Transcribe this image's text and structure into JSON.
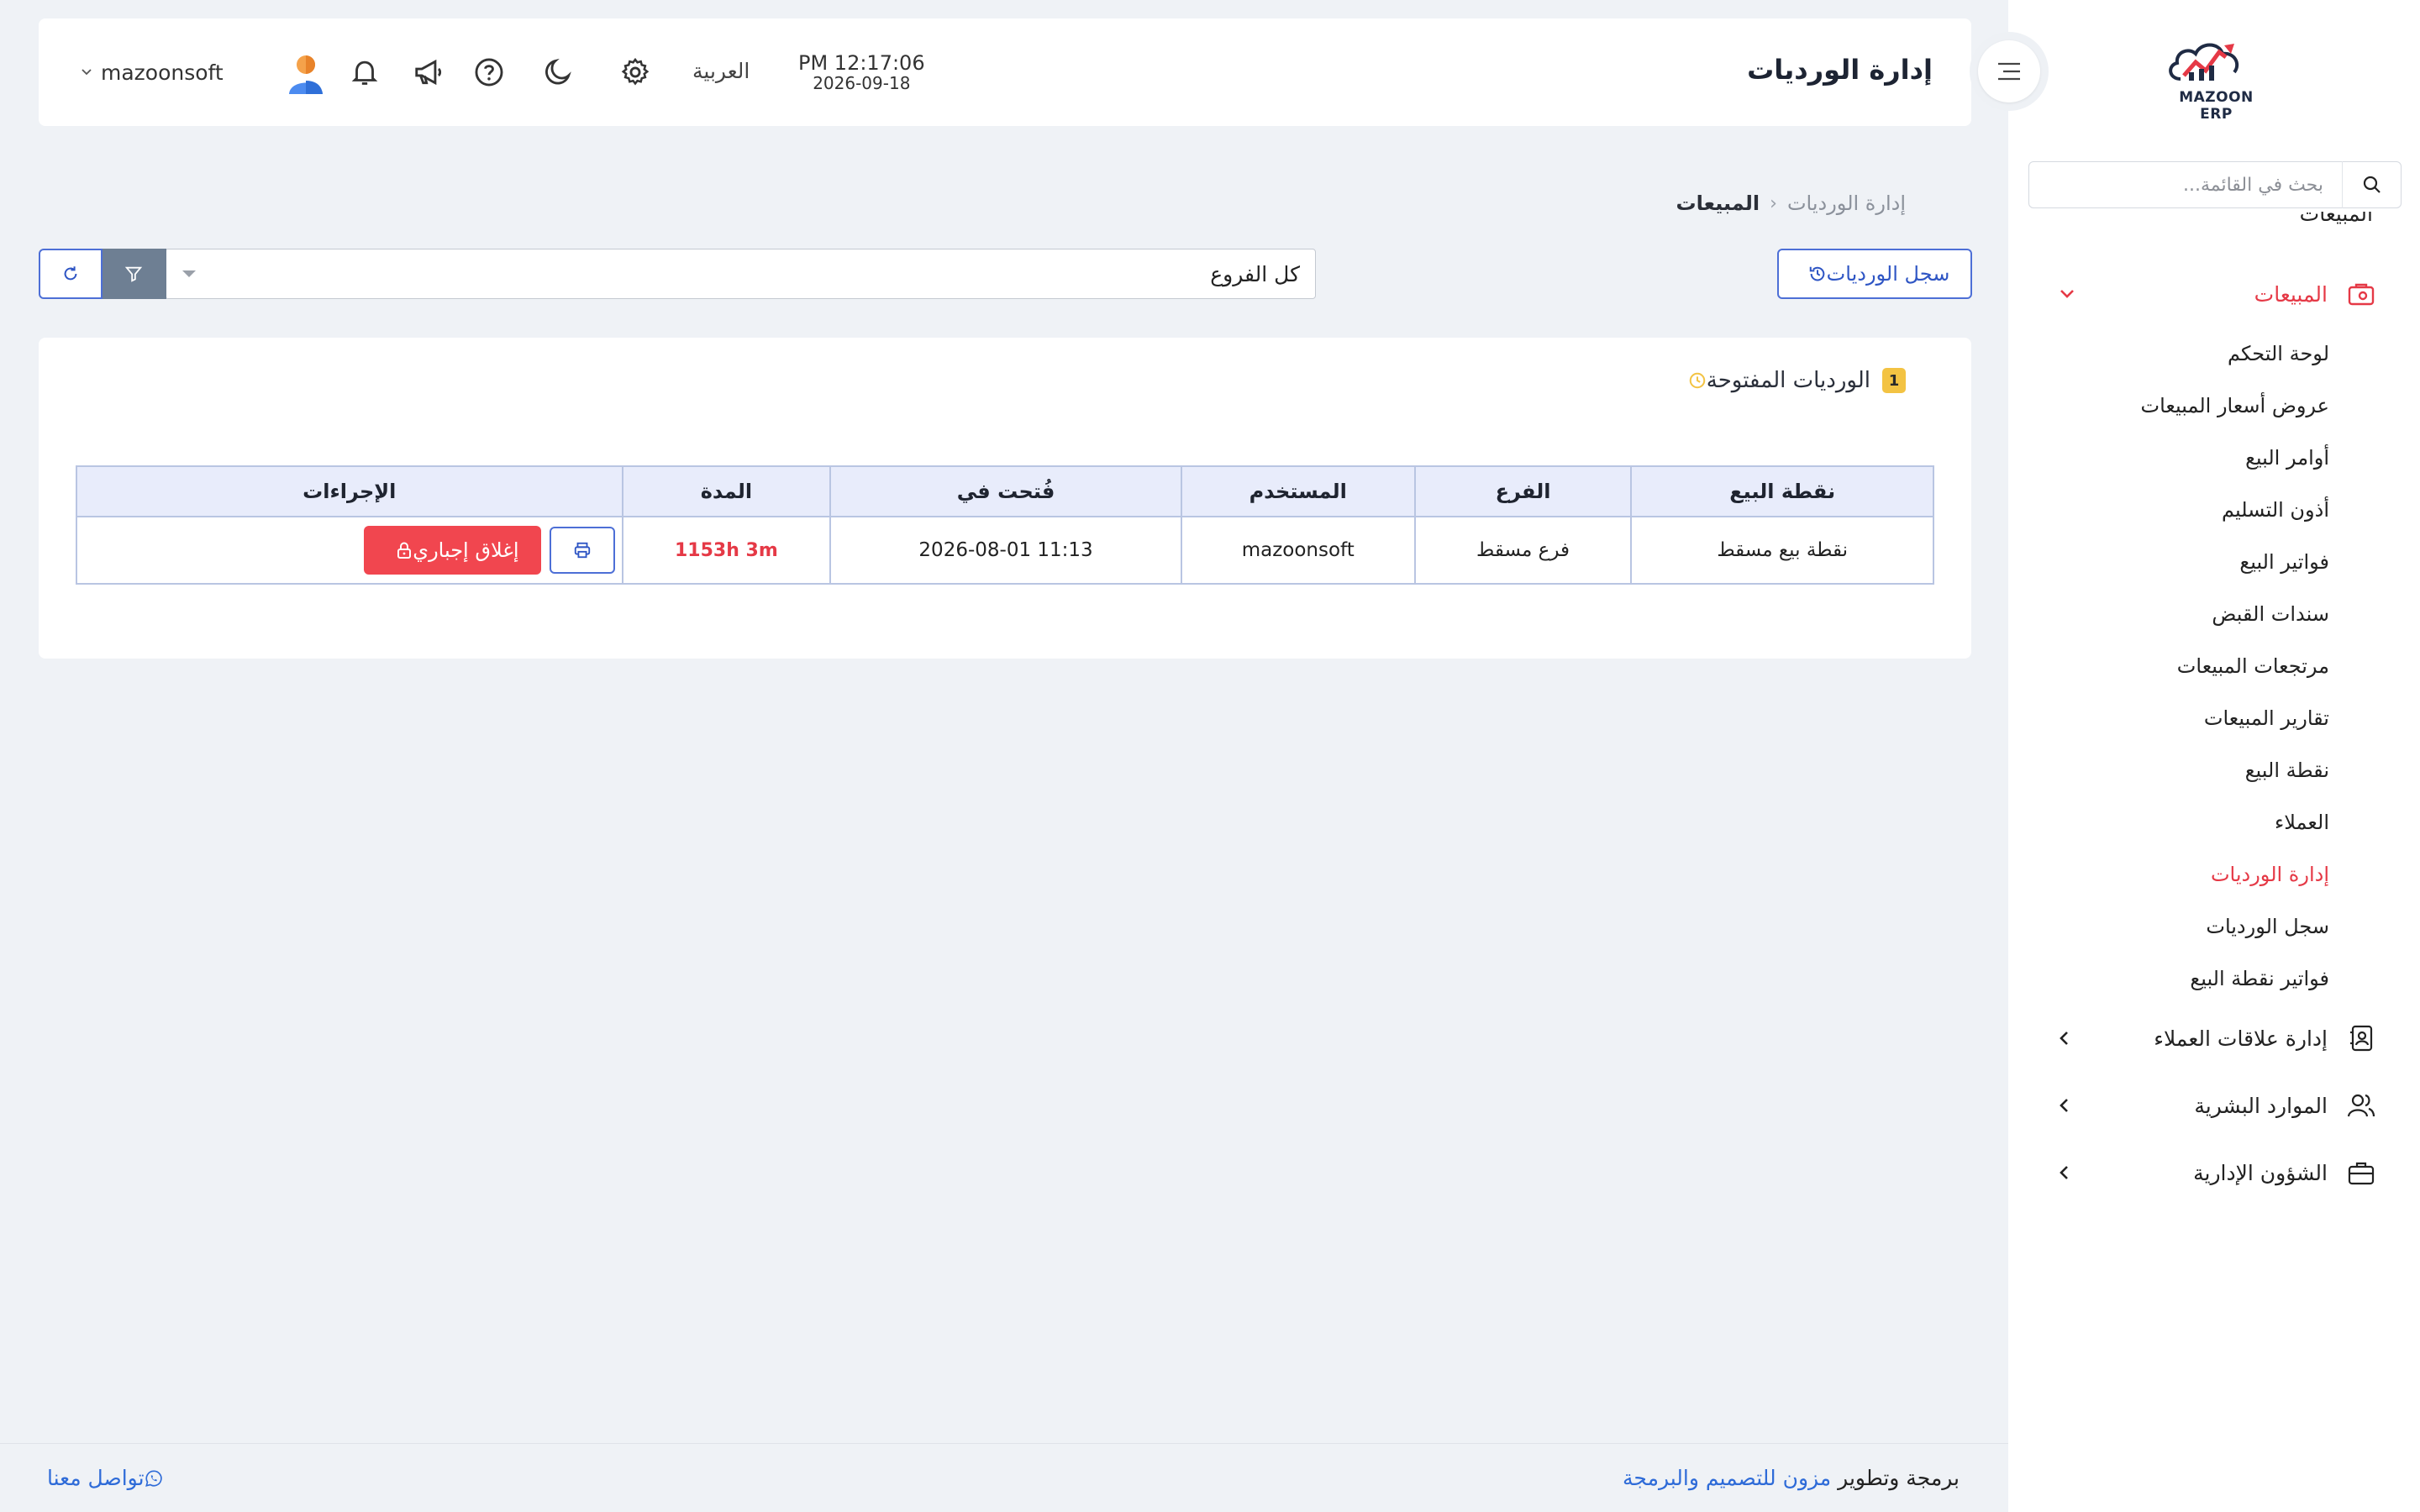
{
  "app": {
    "brand": "MAZOON ERP",
    "page_title": "إدارة الورديات"
  },
  "colors": {
    "accent_blue": "#2e55c4",
    "accent_red": "#e53946",
    "badge_yellow": "#f3c343",
    "filter_gray": "#6e7f93"
  },
  "header": {
    "time": "PM 12:17:06",
    "date": "2026-09-18",
    "language": "العربية",
    "username": "mazoonsoft",
    "icons": [
      "settings-icon",
      "moon-icon",
      "help-icon",
      "megaphone-icon",
      "bell-icon"
    ]
  },
  "sidebar": {
    "search_placeholder": "بحث في القائمة...",
    "partial_item": "المبيعات",
    "sales_label": "المبيعات",
    "sales_subitems": [
      "لوحة التحكم",
      "عروض أسعار المبيعات",
      "أوامر البيع",
      "أذون التسليم",
      "فواتير البيع",
      "سندات القبض",
      "مرتجعات المبيعات",
      "تقارير المبيعات",
      "نقطة البيع",
      "العملاء",
      "إدارة الورديات",
      "سجل الورديات",
      "فواتير نقطة البيع"
    ],
    "active_subitem_index": 10,
    "groups": [
      {
        "label": "إدارة علاقات العملاء",
        "icon": "contact-book-icon"
      },
      {
        "label": "الموارد البشرية",
        "icon": "users-icon"
      },
      {
        "label": "الشؤون الإدارية",
        "icon": "briefcase-icon"
      }
    ]
  },
  "breadcrumb": {
    "parent": "المبيعات",
    "current": "إدارة الورديات"
  },
  "toolbar": {
    "shift_log_label": "سجل الورديات",
    "branch_filter_value": "كل الفروع"
  },
  "open_shifts": {
    "title": "الورديات المفتوحة",
    "count": "1",
    "columns": [
      "نقطة البيع",
      "الفرع",
      "المستخدم",
      "فُتحت في",
      "المدة",
      "الإجراءات"
    ],
    "rows": [
      {
        "pos": "نقطة بيع مسقط",
        "branch": "فرع مسقط",
        "user": "mazoonsoft",
        "opened_at": "2026-08-01 11:13",
        "duration": "1153h 3m",
        "force_close_label": "إغلاق إجباري"
      }
    ]
  },
  "footer": {
    "credit_prefix": "برمجة وتطوير",
    "credit_link": "مزون للتصميم والبرمجة",
    "contact": "تواصل معنا"
  }
}
